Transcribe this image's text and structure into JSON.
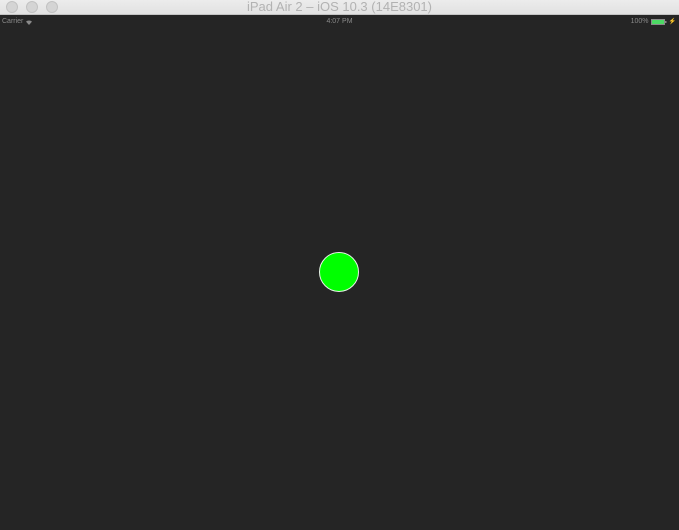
{
  "window": {
    "title": "iPad Air 2 – iOS 10.3 (14E8301)"
  },
  "statusbar": {
    "carrier": "Carrier",
    "time": "4:07 PM",
    "battery_percent": "100%",
    "icons": [
      "wifi-icon",
      "battery-icon",
      "charge-icon"
    ]
  },
  "content": {
    "dot_color": "#00ff00",
    "background_color": "#252525"
  },
  "colors": {
    "battery_fill": "#4cd964"
  }
}
